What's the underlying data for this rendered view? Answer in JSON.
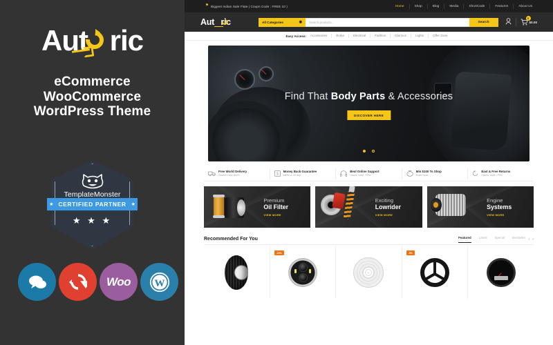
{
  "left_panel": {
    "brand": "Autoric",
    "tagline": [
      "eCommerce",
      "WooCommerce",
      "WordPress Theme"
    ],
    "badge": {
      "vendor": "TemplateMonster",
      "certification": "CERTIFIED PARTNER",
      "star": "★",
      "stars": "★ ★ ★",
      "cat_icon": "monster-cat-icon"
    },
    "icons": [
      {
        "name": "support-chat-icon",
        "label": "",
        "color": "#1b7aa8"
      },
      {
        "name": "free-updates-icon",
        "label": "",
        "color": "#e0402f"
      },
      {
        "name": "woocommerce-icon",
        "label": "Woo",
        "color": "#9a5d9e"
      },
      {
        "name": "wordpress-icon",
        "label": "W",
        "color": "#2b7fab"
      }
    ]
  },
  "site": {
    "topbar": {
      "promo_text": "Biggest Indian Sale Flate | Coupn Code : FREE 10 )",
      "nav": [
        {
          "label": "Home",
          "active": true
        },
        {
          "label": "Shop",
          "active": false
        },
        {
          "label": "Blog",
          "active": false
        },
        {
          "label": "Media",
          "active": false
        },
        {
          "label": "ShortCode",
          "active": false
        },
        {
          "label": "Features",
          "active": false
        },
        {
          "label": "About Us",
          "active": false
        }
      ]
    },
    "header": {
      "logo": "Autoric",
      "logo_a": "Aut",
      "logo_b": "ric",
      "categories_label": "All Categories",
      "search_placeholder": "Search products..",
      "search_button": "Search",
      "cart_count": "0",
      "cart_total": "$0.00"
    },
    "easy_access": {
      "label": "Easy Access:",
      "links": [
        "Accessories",
        "Brake",
        "Electrical",
        "Fashion",
        "Glorious",
        "Lights",
        "Offer Zone"
      ]
    },
    "hero": {
      "heading_pre": "Find That ",
      "heading_bold": "Body Parts",
      "heading_post": " & Accessories",
      "button": "DISCOVER HERE",
      "slides": 2,
      "active_slide": 1
    },
    "services": [
      {
        "icon": "truck-icon",
        "title": "Free World Delivery",
        "subtitle": "Orders Over $100"
      },
      {
        "icon": "money-icon",
        "title": "Money Back Guarantee",
        "subtitle": "within a 30 day"
      },
      {
        "icon": "headset-icon",
        "title": "Best Online Support",
        "subtitle": "Hours: 9AM -7PM"
      },
      {
        "icon": "piggy-icon",
        "title": "Min $100 To Shop",
        "subtitle": "Enter Now"
      },
      {
        "icon": "return-icon",
        "title": "East & Free Returns",
        "subtitle": "Hours: 9AM -7PM"
      }
    ],
    "promo_cards": [
      {
        "art": "oil-filter-art",
        "sub": "Premium",
        "title": "Oil Filter",
        "cta": "VIEW MORE"
      },
      {
        "art": "lowrider-art",
        "sub": "Exciting",
        "title": "Lowrider",
        "cta": "VIEW MORE"
      },
      {
        "art": "alternator-art",
        "sub": "Engine",
        "title": "Systems",
        "cta": "VIEW MORE"
      }
    ],
    "recommended": {
      "title": "Recommended For You",
      "tabs": [
        {
          "label": "Featured",
          "active": true
        },
        {
          "label": "Latest",
          "active": false
        },
        {
          "label": "Special",
          "active": false
        },
        {
          "label": "Bestseller",
          "active": false
        }
      ],
      "prev": "‹",
      "next": "›",
      "products": [
        {
          "art": "tire-product",
          "badge": ""
        },
        {
          "art": "headlight-product",
          "badge": "-10%"
        },
        {
          "art": "brake-rotor-product",
          "badge": ""
        },
        {
          "art": "steering-wheel-product",
          "badge": "-5%"
        },
        {
          "art": "speedometer-product",
          "badge": ""
        }
      ]
    }
  },
  "colors": {
    "brand_yellow": "#f5c518",
    "panel_dark": "#333333",
    "badge_blue": "#3d9ae2",
    "sale_orange": "#ef7215"
  }
}
